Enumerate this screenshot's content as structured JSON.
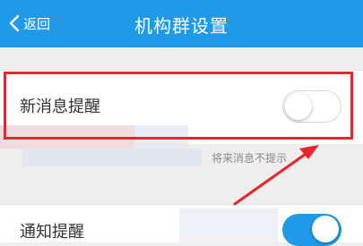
{
  "navbar": {
    "back_label": "返回",
    "title": "机构群设置",
    "back_icon": "chevron-left-icon"
  },
  "settings": {
    "new_message": {
      "label": "新消息提醒",
      "enabled": false
    },
    "hint_text": "将来消息不提示",
    "notification": {
      "label": "通知提醒",
      "enabled": true
    }
  },
  "colors": {
    "navbar": "#1e9ae8",
    "highlight": "#e8242c",
    "toggle_on": "#1e9ae8",
    "background": "#eeeeee"
  }
}
